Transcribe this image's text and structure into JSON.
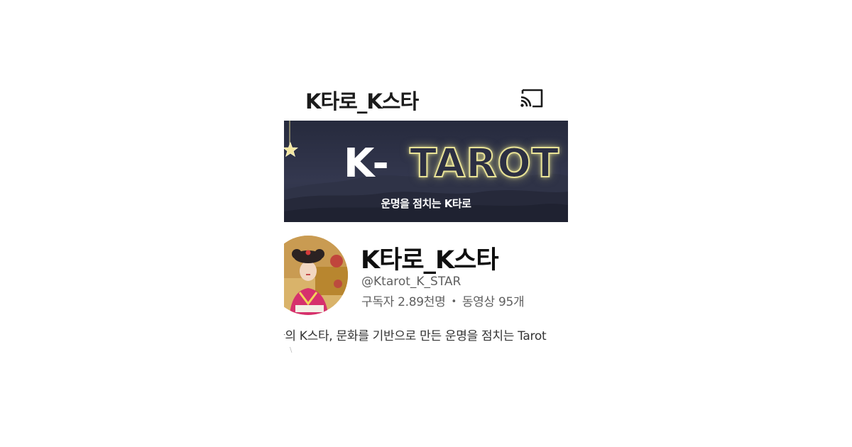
{
  "header": {
    "title": "K타로_K스타",
    "cast_icon": "cast-icon"
  },
  "banner": {
    "title_left": "K-",
    "title_right": "TAROT",
    "subtitle": "운명을 점치는 K타로",
    "star_icon": "star-icon",
    "colors": {
      "sky_top": "#2a2d42",
      "sky_bottom": "#3b3f57",
      "glow": "#e8e296"
    }
  },
  "channel": {
    "avatar_icon": "avatar-icon",
    "name": "K타로_K스타",
    "handle": "@Ktarot_K_STAR",
    "subscribers": "구독자 2.89천명",
    "separator": "•",
    "videos": "동영상 95개",
    "description": "국의 K스타, 문화를 기반으로 만든 운명을 점치는 Tarot",
    "fade_mark": "\\"
  }
}
